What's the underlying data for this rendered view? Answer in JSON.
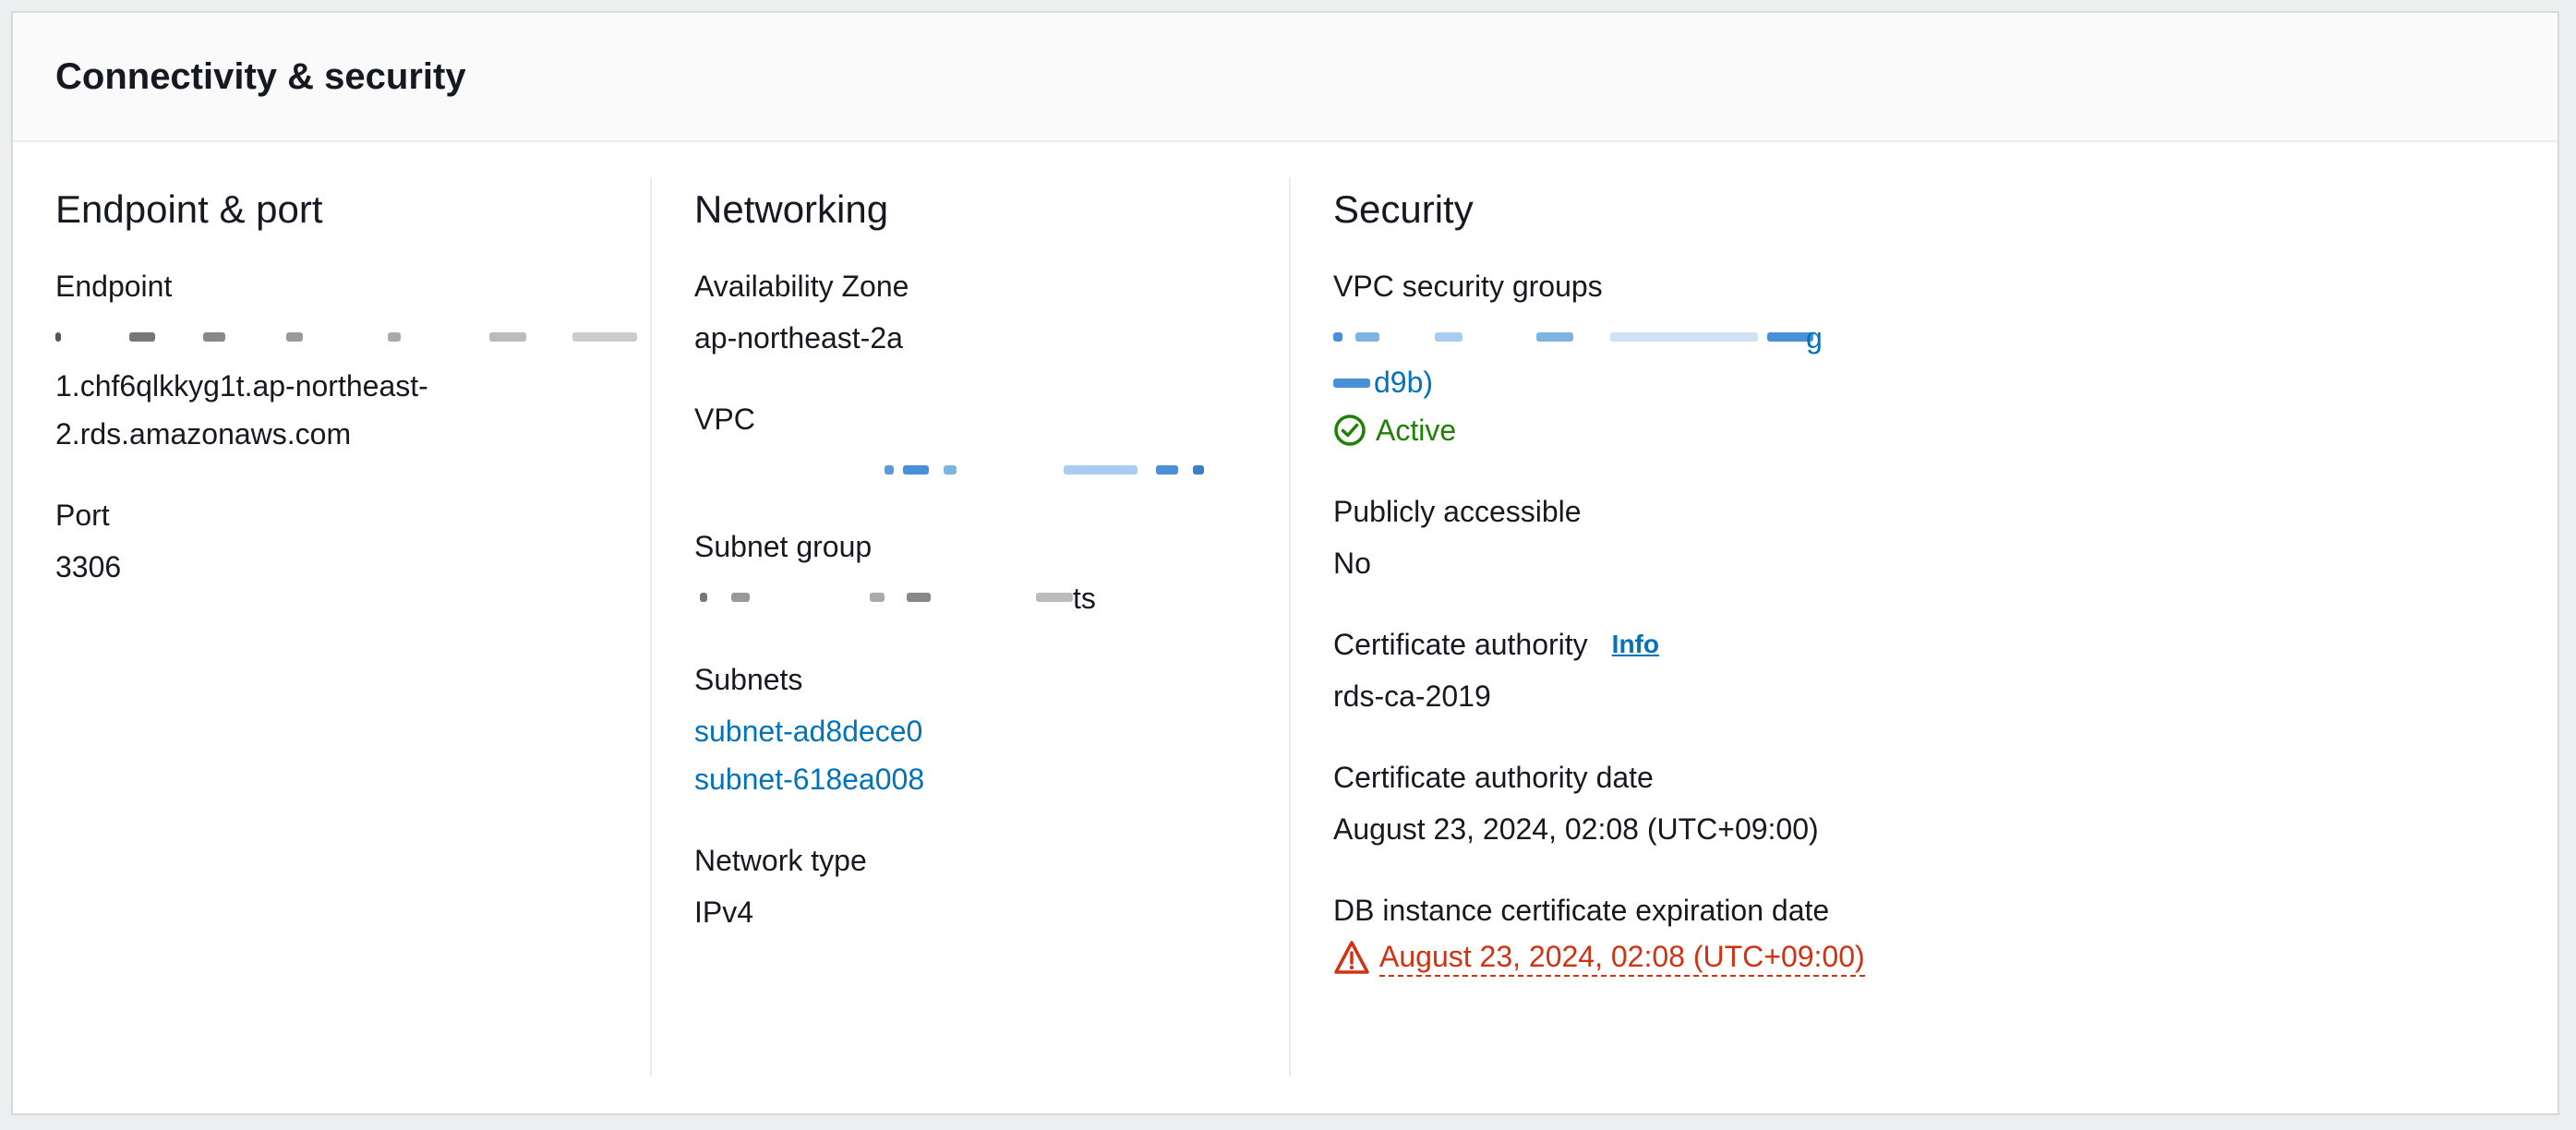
{
  "panel": {
    "title": "Connectivity & security"
  },
  "endpoint_port": {
    "heading": "Endpoint & port",
    "endpoint_label": "Endpoint",
    "endpoint_line2": "1.chf6qlkkyg1t.ap-northeast-",
    "endpoint_line3": "2.rds.amazonaws.com",
    "port_label": "Port",
    "port_value": "3306"
  },
  "networking": {
    "heading": "Networking",
    "az_label": "Availability Zone",
    "az_value": "ap-northeast-2a",
    "vpc_label": "VPC",
    "subnet_group_label": "Subnet group",
    "subnet_group_tail": "ts",
    "subnets_label": "Subnets",
    "subnets": [
      "subnet-ad8dece0",
      "subnet-618ea008"
    ],
    "network_type_label": "Network type",
    "network_type_value": "IPv4"
  },
  "security": {
    "heading": "Security",
    "vpc_sg_label": "VPC security groups",
    "vpc_sg_tail1": "g",
    "vpc_sg_tail2": "d9b)",
    "vpc_sg_status": "Active",
    "public_label": "Publicly accessible",
    "public_value": "No",
    "ca_label": "Certificate authority",
    "ca_info": "Info",
    "ca_value": "rds-ca-2019",
    "ca_date_label": "Certificate authority date",
    "ca_date_value": "August 23, 2024, 02:08 (UTC+09:00)",
    "expiry_label": "DB instance certificate expiration date",
    "expiry_value": "August 23, 2024, 02:08 (UTC+09:00)"
  },
  "colors": {
    "link": "#0073bb",
    "success": "#1d8102",
    "error": "#d13212",
    "text": "#16191f",
    "border": "#eaeded"
  }
}
